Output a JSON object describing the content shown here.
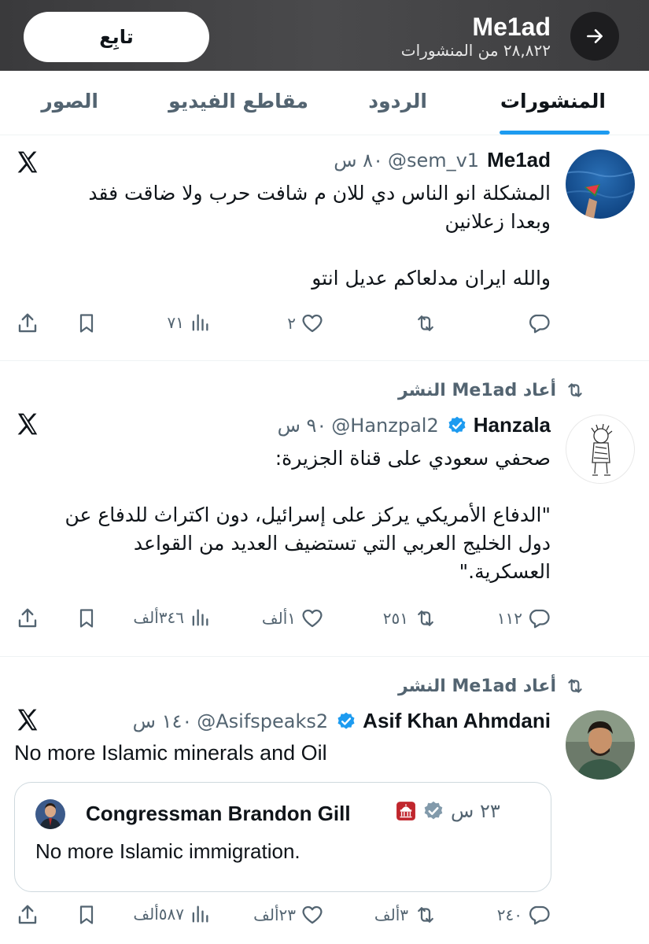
{
  "header": {
    "name": "Me1ad",
    "post_count": "٢٨,٨٢٢ من المنشورات",
    "follow_label": "تابِع"
  },
  "tabs": [
    {
      "label": "المنشورات",
      "active": true
    },
    {
      "label": "الردود",
      "active": false
    },
    {
      "label": "مقاطع الفيديو",
      "active": false
    },
    {
      "label": "الصور",
      "active": false
    }
  ],
  "posts": [
    {
      "author": "Me1ad",
      "handle": "@sem_v1",
      "time": "٨٠ س",
      "text": "المشكلة انو الناس دي للان م شافت حرب ولا ضاقت فقد\nوبعدا زعلانين\n\nوالله ايران مدلعاكم عديل انتو",
      "replies": "",
      "reposts": "",
      "likes": "٢",
      "views": "٧١"
    },
    {
      "repost_label": "أعاد Me1ad النشر",
      "author": "Hanzala",
      "handle": "@Hanzpal2",
      "time": "٩٠ س",
      "text": "صحفي سعودي على قناة الجزيرة:\n\n\"الدفاع الأمريكي يركز على إسرائيل، دون اكتراث للدفاع عن\nدول الخليج العربي التي تستضيف العديد من القواعد\nالعسكرية.\"",
      "replies": "١١٢",
      "reposts": "٢٥١",
      "likes": "١ألف",
      "views": "٣٤٦ألف"
    },
    {
      "repost_label": "أعاد Me1ad النشر",
      "author": "Asif Khan Ahmdani",
      "handle": "@Asifspeaks2",
      "time": "١٤٠ س",
      "text": "No more Islamic minerals and Oil",
      "replies": "٢٤٠",
      "reposts": "٣ألف",
      "likes": "٢٣ألف",
      "views": "٥٨٧ألف",
      "quote": {
        "author": "Congressman Brandon Gill",
        "time": "٢٣ س",
        "text": "No more Islamic immigration."
      }
    }
  ],
  "colors": {
    "accent": "#1d9bf0",
    "secondary_text": "#536471",
    "header_bg": "#3a3a3c"
  }
}
